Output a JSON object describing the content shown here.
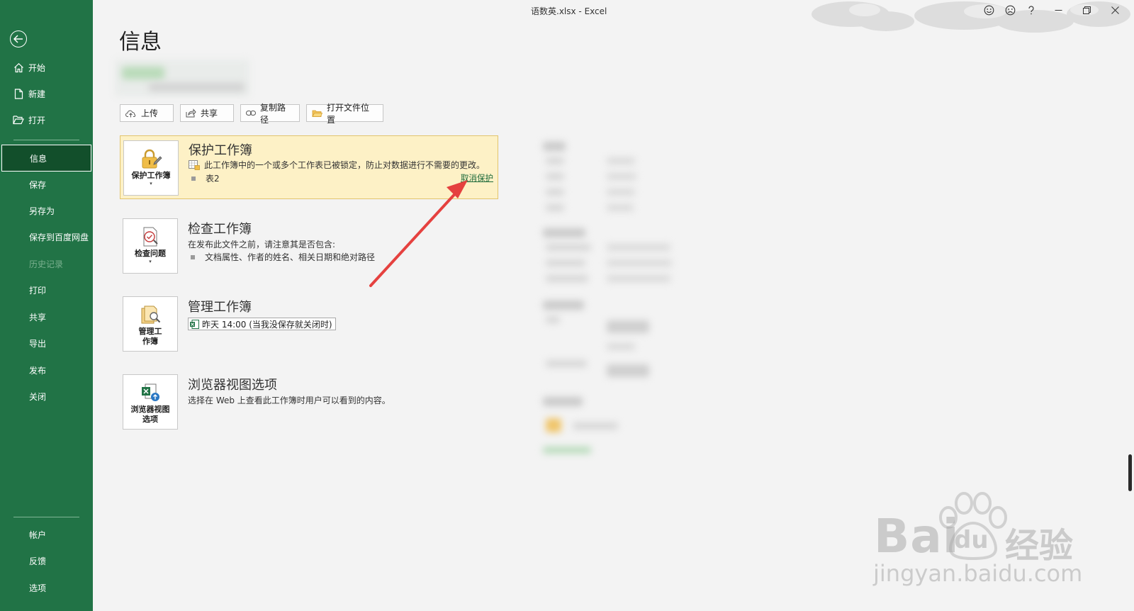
{
  "window": {
    "title": "语数英.xlsx  -  Excel"
  },
  "sidebar": {
    "top_items": [
      {
        "label": "开始",
        "icon": "home-icon"
      },
      {
        "label": "新建",
        "icon": "new-file-icon"
      },
      {
        "label": "打开",
        "icon": "open-folder-icon"
      }
    ],
    "items": [
      {
        "label": "信息",
        "state": "active"
      },
      {
        "label": "保存"
      },
      {
        "label": "另存为"
      },
      {
        "label": "保存到百度网盘"
      },
      {
        "label": "历史记录",
        "state": "disabled"
      },
      {
        "label": "打印"
      },
      {
        "label": "共享"
      },
      {
        "label": "导出"
      },
      {
        "label": "发布"
      },
      {
        "label": "关闭"
      }
    ],
    "bottom_items": [
      {
        "label": "帐户"
      },
      {
        "label": "反馈"
      },
      {
        "label": "选项"
      }
    ]
  },
  "main": {
    "title": "信息",
    "path_buttons": [
      {
        "label": "上传",
        "icon": "upload-icon"
      },
      {
        "label": "共享",
        "icon": "share-icon"
      },
      {
        "label": "复制路径",
        "icon": "link-icon"
      },
      {
        "label": "打开文件位置",
        "icon": "folder-icon"
      }
    ],
    "protect": {
      "button_label": "保护工作簿",
      "title": "保护工作簿",
      "description": "此工作簿中的一个或多个工作表已被锁定，防止对数据进行不需要的更改。",
      "sheet": "表2",
      "link": "取消保护"
    },
    "inspect": {
      "button_label": "检查问题",
      "title": "检查工作簿",
      "description": "在发布此文件之前，请注意其是否包含:",
      "bullet": "文档属性、作者的姓名、相关日期和绝对路径"
    },
    "manage": {
      "button_label": "管理工\n作簿",
      "title": "管理工作簿",
      "version": "昨天 14:00 (当我没保存就关闭时)"
    },
    "browser": {
      "button_label": "浏览器视图\n选项",
      "title": "浏览器视图选项",
      "description": "选择在 Web 上查看此工作簿时用户可以看到的内容。"
    }
  },
  "watermark": {
    "brand": "Bai",
    "brand2": "du",
    "brand_cn": "经验",
    "url": "jingyan.baidu.com"
  },
  "colors": {
    "sidebar": "#217346",
    "active_item": "#124f2b",
    "highlight": "#fdf1c6",
    "arrow": "#e5413f"
  }
}
